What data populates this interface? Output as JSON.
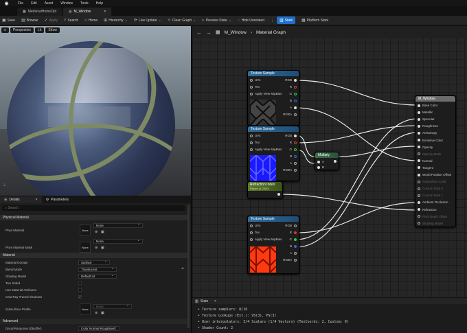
{
  "menubar": {
    "items": [
      "File",
      "Edit",
      "Asset",
      "Window",
      "Tools",
      "Help"
    ]
  },
  "tabs": [
    {
      "label": "MedievalHomeOpt",
      "active": false
    },
    {
      "label": "M_Window",
      "active": true
    }
  ],
  "toolbar": {
    "save": "Save",
    "browse": "Browse",
    "apply": "Apply",
    "search": "Search",
    "home": "Home",
    "hierarchy": "Hierarchy",
    "live_update": "Live Update",
    "clean_graph": "Clean Graph",
    "preview_state": "Preview State",
    "hide_unrelated": "Hide Unrelated",
    "stats": "Stats",
    "platform_stats": "Platform Stats"
  },
  "viewport": {
    "perspective": "Perspective",
    "lit": "Lit",
    "show": "Show"
  },
  "details": {
    "tab_details": "Details",
    "tab_parameters": "Parameters",
    "search_placeholder": "Search",
    "physical_material": "Physical Material",
    "phys_material": "Phys Material",
    "phys_material_value": "None",
    "phys_material_thumb": "None",
    "phys_material_mask": "Phys Material Mask",
    "phys_material_mask_value": "None",
    "phys_material_mask_thumb": "None",
    "material": "Material",
    "material_domain": "Material Domain",
    "material_domain_value": "Surface",
    "blend_mode": "Blend Mode",
    "blend_mode_value": "Translucent",
    "shading_model": "Shading Model",
    "shading_model_value": "Default Lit",
    "two_sided": "Two Sided",
    "use_material_attributes": "Use Material Attributes",
    "cast_ray_traced_shadows": "Cast Ray Traced Shadows",
    "subsurface_profile": "Subsurface Profile",
    "subsurface_value": "None",
    "subsurface_thumb": "None",
    "advanced": "Advanced",
    "decal_response": "Decal Response (DBuffer)",
    "decal_response_value": "Color Normal Roughness"
  },
  "graph": {
    "breadcrumb_asset": "M_Window",
    "breadcrumb_graph": "Material Graph",
    "tex1": {
      "title": "Texture Sample",
      "in": [
        "UVs",
        "Tex",
        "Apply View MipBias"
      ],
      "out": [
        "RGB",
        "R",
        "G",
        "B",
        "A",
        "RGBA"
      ]
    },
    "tex2": {
      "title": "Texture Sample",
      "in": [
        "UVs",
        "Tex",
        "Apply View MipBias"
      ],
      "out": [
        "RGB",
        "R",
        "G",
        "B",
        "A",
        "RGBA"
      ]
    },
    "tex3": {
      "title": "Texture Sample",
      "in": [
        "UVs",
        "Tex",
        "Apply View MipBias"
      ],
      "out": [
        "RGB",
        "R",
        "G",
        "B",
        "A",
        "RGBA"
      ]
    },
    "multiply": {
      "title": "Multiply",
      "pins": [
        "A",
        "B"
      ]
    },
    "refraction": {
      "title": "Refraction Index",
      "subtitle": "Param (1.2000)"
    },
    "output": {
      "title": "M_Window",
      "pins": [
        "Base Color",
        "Metallic",
        "Specular",
        "Roughness",
        "Anisotropy",
        "Emissive Color",
        "Opacity",
        "Opacity Mask",
        "Normal",
        "Tangent",
        "World Position Offset",
        "Subsurface Color",
        "Custom Data 0",
        "Custom Data 1",
        "Ambient Occlusion",
        "Refraction",
        "Pixel Depth Offset",
        "Shading Model"
      ]
    }
  },
  "stats": {
    "title": "Stats",
    "lines": [
      "Texture samplers: 8/16",
      "Texture Lookups (Est.): VS(3), PS(3)",
      "User interpolators: 3/4 Scalars (1/4 Vectors) (TexCoords: 2, Custom: 0)",
      "Shader Count: 2"
    ]
  }
}
